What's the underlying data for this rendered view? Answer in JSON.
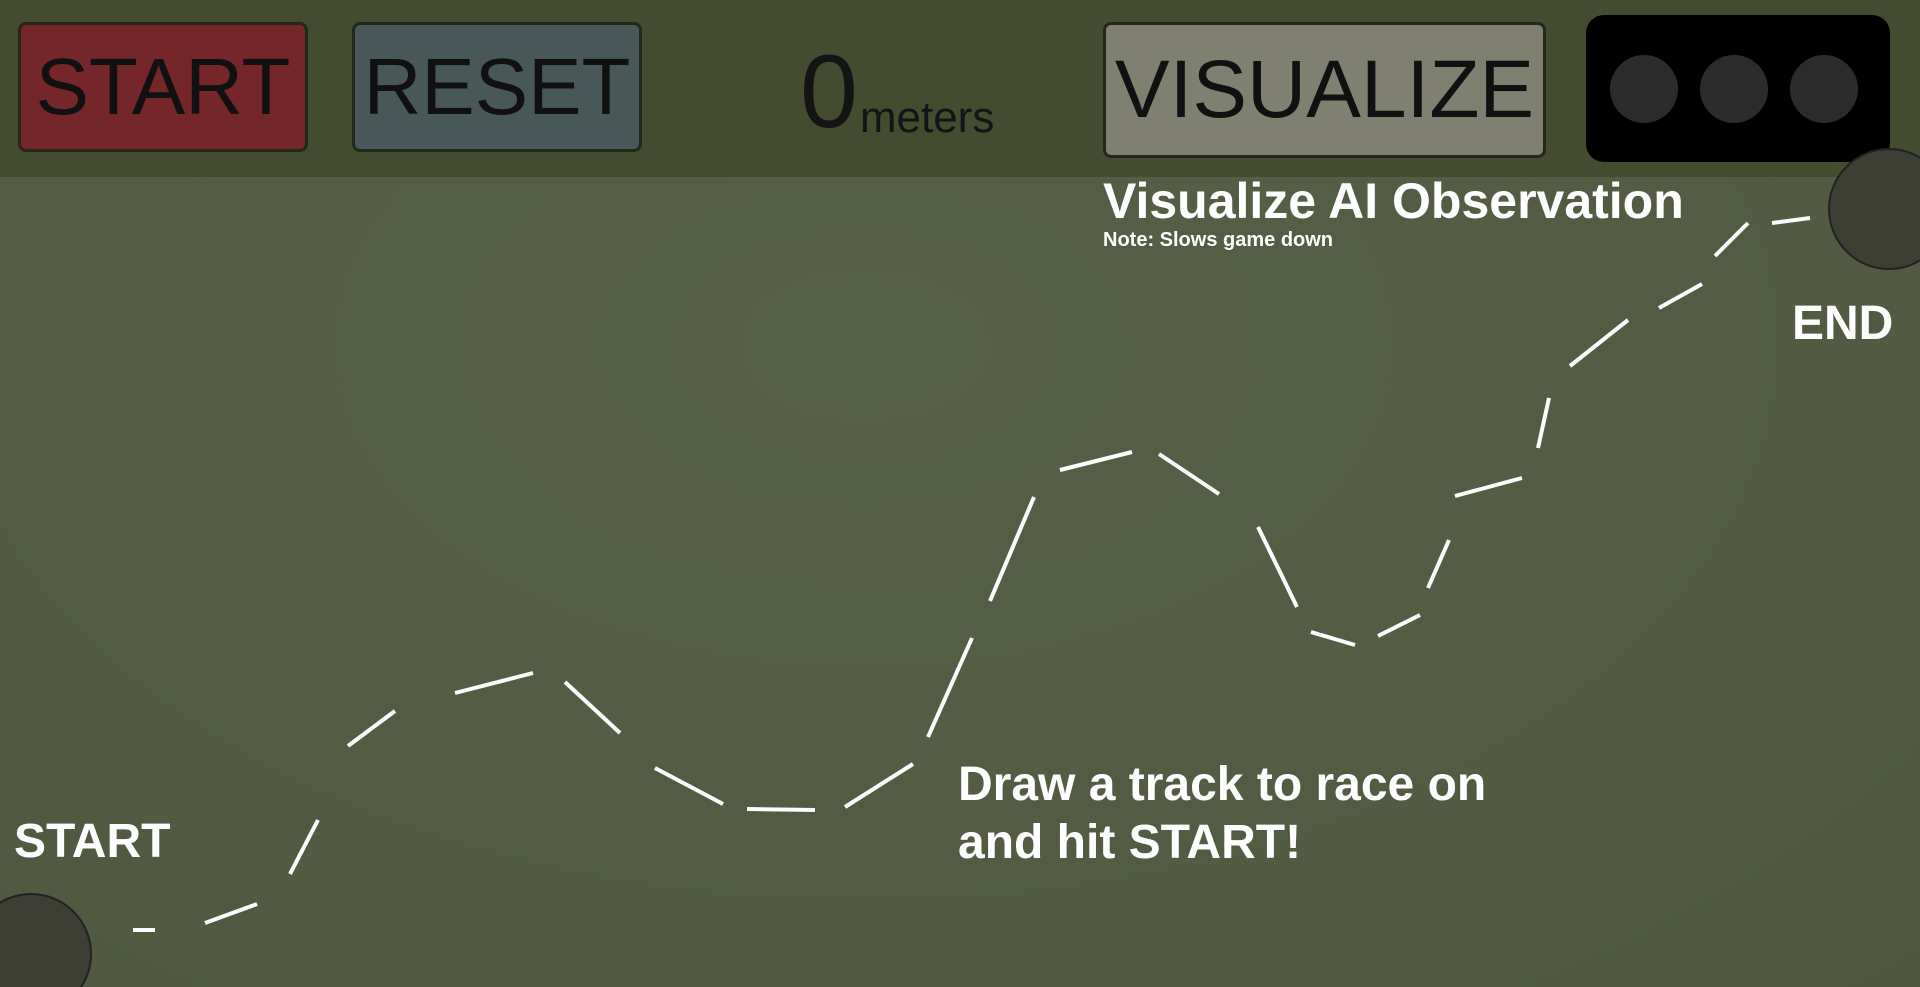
{
  "toolbar": {
    "start_label": "START",
    "reset_label": "RESET",
    "distance_value": "0",
    "distance_unit": "meters",
    "visualize_label": "VISUALIZE",
    "lights": [
      "off",
      "off",
      "off"
    ]
  },
  "visualize_info": {
    "title": "Visualize AI Observation",
    "note": "Note: Slows game down"
  },
  "track": {
    "start_label": "START",
    "end_label": "END",
    "instructions_line1": "Draw a track to race on",
    "instructions_line2": "and hit START!"
  },
  "colors": {
    "background": "#535c42",
    "toolbar": "#444c30",
    "start_button": "#742628",
    "reset_button": "#485859",
    "visualize_button": "#808070",
    "lights_panel": "#000000",
    "light_off": "#2b2b2b",
    "node": "#3d3f35",
    "track_line": "#ffffff"
  }
}
